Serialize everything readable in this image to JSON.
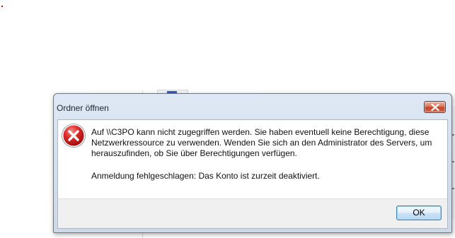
{
  "dialog": {
    "title": "Ordner öffnen",
    "icon": "error-icon",
    "message": "Auf \\\\C3PO kann nicht zugegriffen werden. Sie haben eventuell keine Berechtigung, diese Netzwerkressource zu verwenden. Wenden Sie sich an den Administrator des Servers, um herauszufinden, ob Sie über Berechtigungen verfügen.",
    "detail": "Anmeldung fehlgeschlagen: Das Konto ist zurzeit deaktiviert.",
    "ok_label": "OK",
    "close_icon": "close-icon"
  },
  "colors": {
    "error_red": "#c81f1f",
    "close_button": "#c44524",
    "ok_border": "#3c7fb1",
    "frame": "#cdd9e7"
  }
}
